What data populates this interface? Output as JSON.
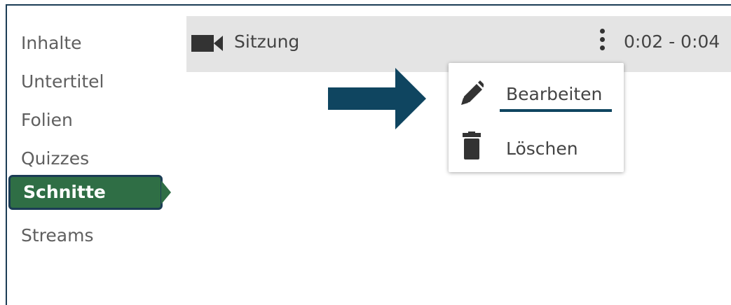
{
  "sidebar": {
    "items": [
      {
        "label": "Inhalte"
      },
      {
        "label": "Untertitel"
      },
      {
        "label": "Folien"
      },
      {
        "label": "Quizzes"
      },
      {
        "label": "Schnitte",
        "active": true
      },
      {
        "label": "Streams"
      }
    ]
  },
  "cut": {
    "title": "Sitzung",
    "time_range": "0:02 - 0:04",
    "icon": "video-camera-icon"
  },
  "context_menu": {
    "edit_label": "Bearbeiten",
    "delete_label": "Löschen",
    "edit_icon": "pencil-icon",
    "delete_icon": "trash-icon"
  },
  "colors": {
    "active_bg": "#2f6e45",
    "accent_navy": "#0f4560",
    "row_bg": "#e4e4e4"
  }
}
